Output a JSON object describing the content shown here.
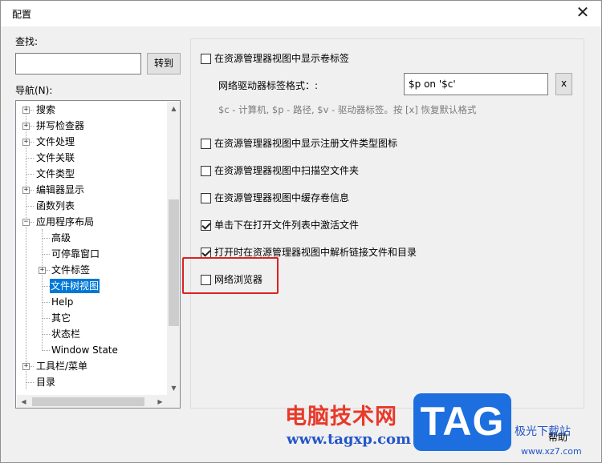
{
  "window": {
    "title": "配置",
    "close_glyph": "✕"
  },
  "left": {
    "find_label": "查找:",
    "search_value": "",
    "goto_label": "转到",
    "nav_label": "导航(N):"
  },
  "tree": {
    "items": [
      {
        "label": "搜索",
        "expander": "+"
      },
      {
        "label": "拼写检查器",
        "expander": "+"
      },
      {
        "label": "文件处理",
        "expander": "+"
      },
      {
        "label": "文件关联",
        "expander": ""
      },
      {
        "label": "文件类型",
        "expander": ""
      },
      {
        "label": "编辑器显示",
        "expander": "+"
      },
      {
        "label": "函数列表",
        "expander": ""
      },
      {
        "label": "应用程序布局",
        "expander": "−"
      },
      {
        "label": "高级",
        "expander": ""
      },
      {
        "label": "可停靠窗口",
        "expander": ""
      },
      {
        "label": "文件标签",
        "expander": "+"
      },
      {
        "label": "文件树视图",
        "expander": "",
        "selected": true
      },
      {
        "label": "Help",
        "expander": ""
      },
      {
        "label": "其它",
        "expander": ""
      },
      {
        "label": "状态栏",
        "expander": ""
      },
      {
        "label": "Window State",
        "expander": ""
      },
      {
        "label": "工具栏/菜单",
        "expander": "+"
      },
      {
        "label": "目录",
        "expander": ""
      }
    ],
    "scroll_up": "▲",
    "scroll_down": "▼",
    "scroll_left": "◀",
    "scroll_right": "▶"
  },
  "options": {
    "show_volume_label": {
      "label": "在资源管理器视图中显示卷标签",
      "checked": false
    },
    "net_drive_label": "网络驱动器标签格式：:",
    "net_drive_value": "$p on '$c'",
    "reset_button": "x",
    "hint": "$c - 计算机, $p - 路径, $v - 驱动器标签。按 [x] 恢复默认格式",
    "show_registered_icons": {
      "label": "在资源管理器视图中显示注册文件类型图标",
      "checked": false
    },
    "scan_empty_folders": {
      "label": "在资源管理器视图中扫描空文件夹",
      "checked": false
    },
    "cache_volume_info": {
      "label": "在资源管理器视图中缓存卷信息",
      "checked": false
    },
    "single_click_activate": {
      "label": "单击下在打开文件列表中激活文件",
      "checked": true
    },
    "resolve_links": {
      "label": "打开时在资源管理器视图中解析链接文件和目录",
      "checked": true
    },
    "network_browser": {
      "label": "网络浏览器",
      "checked": false
    }
  },
  "footer": {
    "help_label": "帮助"
  },
  "watermark": {
    "brand_cn": "电脑技术网",
    "url": "www.tagxp.com",
    "tag": "TAG",
    "site_cn": "极光下载站",
    "site_url": "www.xz7.com"
  },
  "colors": {
    "selection": "#0078d7",
    "highlight_box": "#e02020",
    "watermark_red": "#e8392a",
    "watermark_blue": "#1d6fe0"
  }
}
